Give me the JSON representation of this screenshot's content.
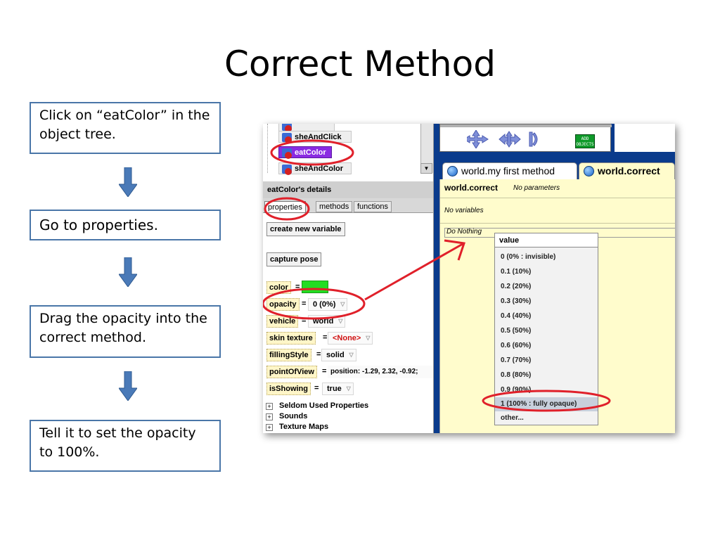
{
  "slide": {
    "title": "Correct Method",
    "steps": [
      "Click on “eatColor” in the object tree.",
      "Go to properties.",
      "Drag the opacity into the correct method.",
      "Tell it to set the opacity to 100%."
    ]
  },
  "screenshot": {
    "tree": {
      "items": [
        "sheAndClick",
        "eatColor",
        "sheAndColor"
      ]
    },
    "details": {
      "title": "eatColor's details",
      "tabs": [
        "properties",
        "methods",
        "functions"
      ],
      "buttons": {
        "create_new_variable": "create new variable",
        "capture_pose": "capture pose"
      },
      "properties": [
        {
          "name": "color",
          "value": ""
        },
        {
          "name": "opacity",
          "value": "0 (0%)"
        },
        {
          "name": "vehicle",
          "value": "world"
        },
        {
          "name": "skin texture",
          "value": "<None>"
        },
        {
          "name": "fillingStyle",
          "value": "solid"
        },
        {
          "name": "pointOfView",
          "value": "position: -1.29, 2.32, -0.92;"
        },
        {
          "name": "isShowing",
          "value": "true"
        }
      ],
      "groups": [
        "Seldom Used Properties",
        "Sounds",
        "Texture Maps"
      ],
      "color_swatch": "#22dd22"
    },
    "scene_controls": {
      "add_objects": "ADD OBJECTS"
    },
    "editor": {
      "tabs": [
        "world.my first method",
        "world.correct"
      ],
      "method_name": "world.correct",
      "params": "No parameters",
      "variables": "No variables",
      "do_nothing": "Do Nothing",
      "dropdown": {
        "header": "value",
        "options": [
          "0 (0% : invisible)",
          "0.1 (10%)",
          "0.2 (20%)",
          "0.3 (30%)",
          "0.4 (40%)",
          "0.5 (50%)",
          "0.6 (60%)",
          "0.7 (70%)",
          "0.8 (80%)",
          "0.9 (90%)",
          "1 (100% : fully opaque)",
          "other..."
        ],
        "highlighted_index": 10
      }
    },
    "colors": {
      "panel_blue": "#0a3b8c",
      "editor_bg": "#fffccc",
      "annotation_red": "#e0202a",
      "step_border": "#4a76a8",
      "arrow_blue": "#4a7ab8"
    }
  }
}
